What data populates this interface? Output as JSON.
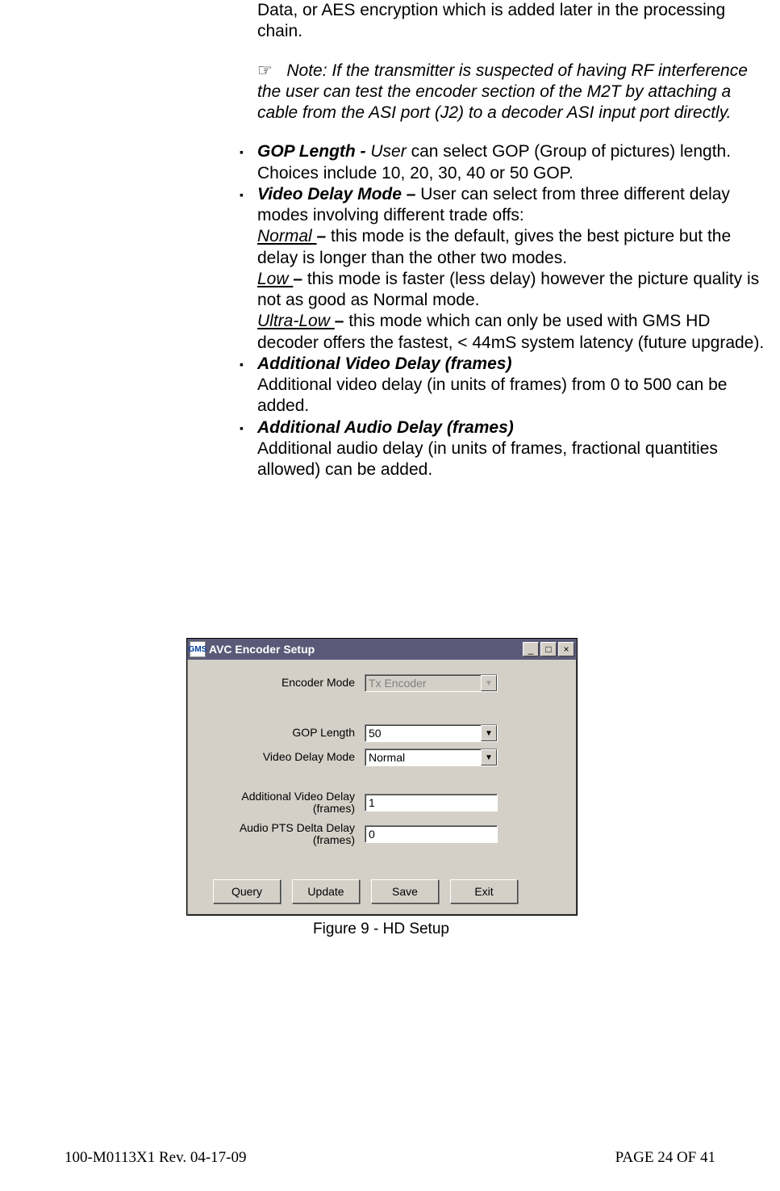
{
  "body": {
    "lead_in": "Data, or AES encryption which is added later in the processing chain.",
    "note_glyph": "☞",
    "note_label": "Note",
    "note_text": ": If the transmitter is suspected of having RF interference the user can test the encoder section of the M2T by attaching a cable from the ASI port (J2) to a decoder ASI input port directly.",
    "bullets": {
      "gop": {
        "title": "GOP Length - ",
        "lead": "User",
        "rest": " can select GOP (Group of pictures) length. Choices include 10, 20, 30, 40 or 50 GOP."
      },
      "vdm": {
        "title": "Video Delay Mode – ",
        "rest": "User can select from three different delay modes involving different  trade offs:",
        "normal_label": "Normal ",
        "normal_dash": "– ",
        "normal_text": "this mode is the default, gives the best picture but the delay is longer than the other two modes.",
        "low_label": "Low ",
        "low_dash": "– ",
        "low_text": "this mode is faster (less delay) however the picture quality is not as good as Normal mode.",
        "ultra_label": "Ultra-Low ",
        "ultra_dash": "– ",
        "ultra_text": "this mode which can only be used with GMS HD decoder offers the fastest, < 44mS system latency (future upgrade)."
      },
      "avd": {
        "title": "Additional Video Delay (frames)",
        "text": "Additional video delay (in units of frames) from 0 to 500 can be added."
      },
      "aad": {
        "title": "Additional Audio Delay (frames)",
        "text": "Additional audio delay (in units of frames, fractional quantities allowed) can be added."
      }
    }
  },
  "dialog": {
    "title": "AVC Encoder Setup",
    "icon_text": "GMS",
    "fields": {
      "encoder_mode": {
        "label": "Encoder Mode",
        "value": "Tx Encoder"
      },
      "gop_length": {
        "label": "GOP Length",
        "value": "50"
      },
      "video_delay": {
        "label": "Video Delay Mode",
        "value": "Normal"
      },
      "add_video": {
        "label": "Additional Video Delay (frames)",
        "value": "1"
      },
      "audio_pts": {
        "label": "Audio PTS Delta Delay (frames)",
        "value": "0"
      }
    },
    "buttons": {
      "query": "Query",
      "update": "Update",
      "save": "Save",
      "exit": "Exit"
    },
    "caption": "Figure 9 - HD Setup"
  },
  "footer": {
    "left": "100-M0113X1 Rev. 04-17-09",
    "right": "PAGE 24 OF 41"
  }
}
